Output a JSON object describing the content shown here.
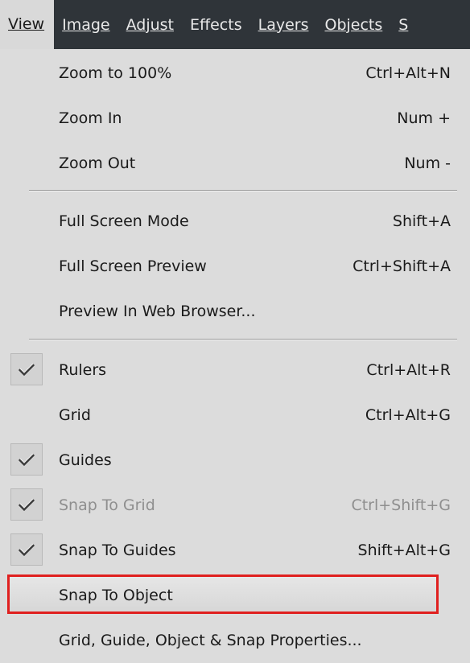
{
  "menubar": {
    "items": [
      {
        "label": "View",
        "active": true
      },
      {
        "label": "Image"
      },
      {
        "label": "Adjust"
      },
      {
        "label": "Effects"
      },
      {
        "label": "Layers"
      },
      {
        "label": "Objects"
      },
      {
        "label": "S"
      }
    ]
  },
  "menu": {
    "zoom_100": {
      "label": "Zoom to 100%",
      "shortcut": "Ctrl+Alt+N"
    },
    "zoom_in": {
      "label": "Zoom In",
      "shortcut": "Num +"
    },
    "zoom_out": {
      "label": "Zoom Out",
      "shortcut": "Num -"
    },
    "full_screen_mode": {
      "label": "Full Screen Mode",
      "shortcut": "Shift+A"
    },
    "full_screen_preview": {
      "label": "Full Screen Preview",
      "shortcut": "Ctrl+Shift+A"
    },
    "preview_web": {
      "label": "Preview In Web Browser..."
    },
    "rulers": {
      "label": "Rulers",
      "shortcut": "Ctrl+Alt+R",
      "checked": true
    },
    "grid": {
      "label": "Grid",
      "shortcut": "Ctrl+Alt+G",
      "checked": false
    },
    "guides": {
      "label": "Guides",
      "checked": true
    },
    "snap_grid": {
      "label": "Snap To Grid",
      "shortcut": "Ctrl+Shift+G",
      "checked": true,
      "disabled": true
    },
    "snap_guides": {
      "label": "Snap To Guides",
      "shortcut": "Shift+Alt+G",
      "checked": true
    },
    "snap_object": {
      "label": "Snap To Object",
      "highlighted": true
    },
    "properties": {
      "label": "Grid, Guide, Object & Snap Properties..."
    }
  },
  "colors": {
    "menubar_bg": "#2f3439",
    "menu_bg": "#dcdcdc",
    "highlight_border": "#e0201f"
  }
}
